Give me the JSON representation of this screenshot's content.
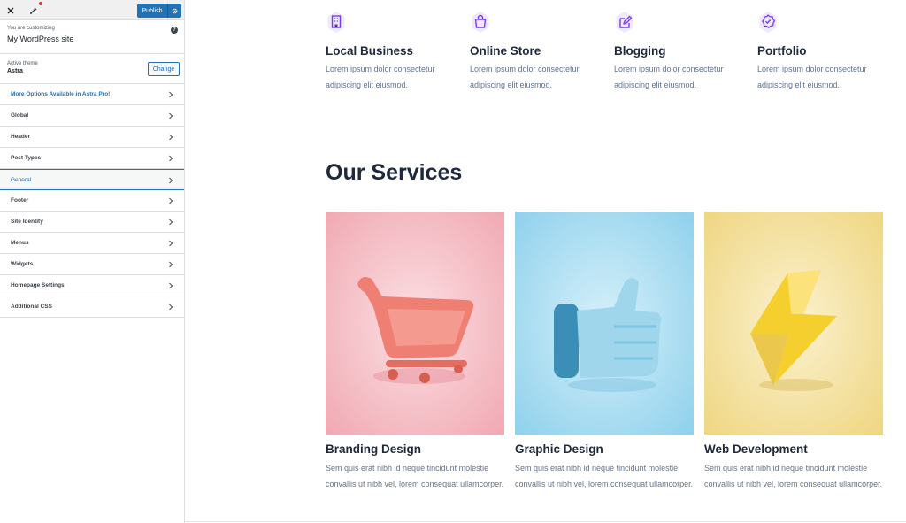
{
  "sidebar": {
    "publish_label": "Publish",
    "customizing_label": "You are customizing",
    "site_title": "My WordPress site",
    "active_theme_label": "Active theme",
    "theme_name": "Astra",
    "change_label": "Change",
    "help_glyph": "?",
    "menu": [
      {
        "label": "More Options Available in Astra Pro!"
      },
      {
        "label": "Global"
      },
      {
        "label": "Header"
      },
      {
        "label": "Post Types"
      },
      {
        "label": "General"
      },
      {
        "label": "Footer"
      },
      {
        "label": "Site Identity"
      },
      {
        "label": "Menus"
      },
      {
        "label": "Widgets"
      },
      {
        "label": "Homepage Settings"
      },
      {
        "label": "Additional CSS"
      }
    ]
  },
  "features": [
    {
      "icon": "building-icon",
      "title": "Local Business",
      "desc": "Lorem ipsum dolor consectetur adipiscing elit eiusmod."
    },
    {
      "icon": "shopping-bag-icon",
      "title": "Online Store",
      "desc": "Lorem ipsum dolor consectetur adipiscing elit eiusmod."
    },
    {
      "icon": "edit-icon",
      "title": "Blogging",
      "desc": "Lorem ipsum dolor consectetur adipiscing elit eiusmod."
    },
    {
      "icon": "badge-check-icon",
      "title": "Portfolio",
      "desc": "Lorem ipsum dolor consectetur adipiscing elit eiusmod."
    }
  ],
  "services": {
    "title": "Our Services",
    "cards": [
      {
        "image": "shopping-cart-image",
        "title": "Branding Design",
        "desc": "Sem quis erat nibh id neque tincidunt molestie convallis ut nibh vel, lorem consequat ullamcorper."
      },
      {
        "image": "thumbs-up-image",
        "title": "Graphic Design",
        "desc": "Sem quis erat nibh id neque tincidunt molestie convallis ut nibh vel, lorem consequat ullamcorper."
      },
      {
        "image": "lightning-bolt-image",
        "title": "Web Development",
        "desc": "Sem quis erat nibh id neque tincidunt molestie convallis ut nibh vel, lorem consequat ullamcorper."
      }
    ]
  },
  "colors": {
    "publish_blue": "#2271b1",
    "accent_purple": "#7c3aed",
    "heading": "#1e293b",
    "body_text": "#64748b",
    "card_pink": "#f3b7bf",
    "card_blue": "#a9dcf0",
    "card_yellow": "#f2df96"
  }
}
